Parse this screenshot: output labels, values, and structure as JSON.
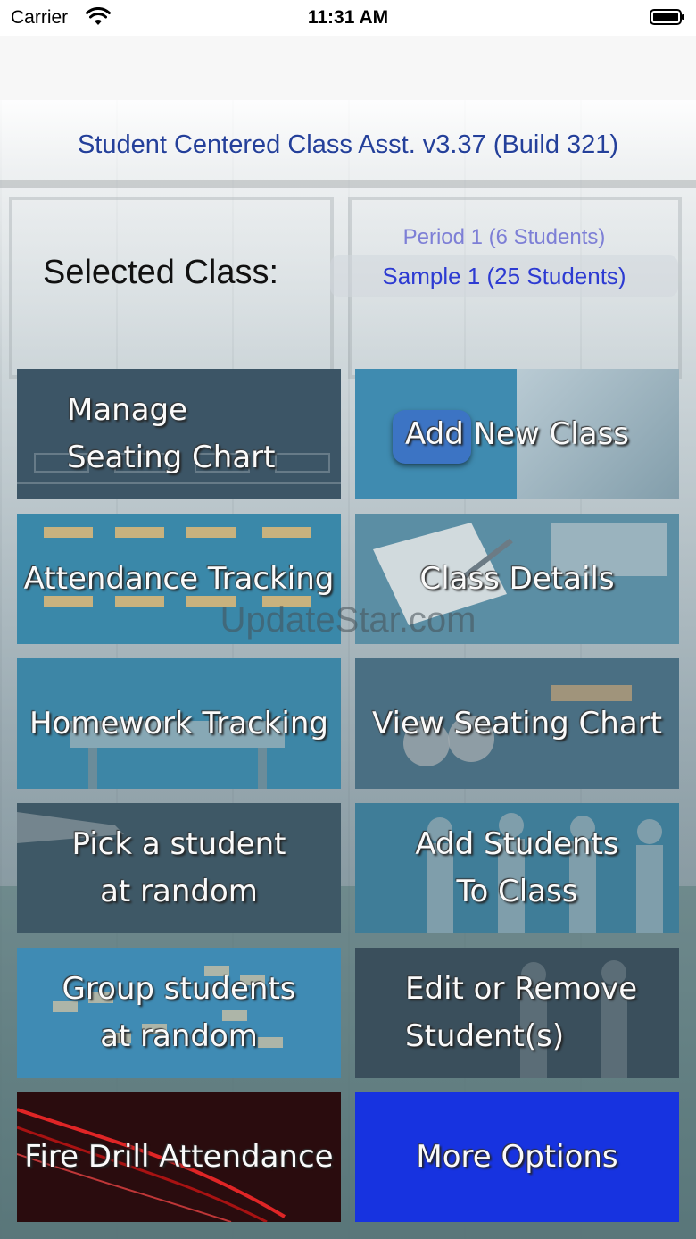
{
  "status_bar": {
    "carrier": "Carrier",
    "time": "11:31 AM",
    "wifi_icon": "wifi-icon",
    "battery_icon": "battery-icon"
  },
  "app_title": "Student Centered Class Asst. v3.37 (Build 321)",
  "selected_class": {
    "label": "Selected Class:",
    "options": [
      "Period 1 (6 Students)",
      "Sample 1 (25 Students)"
    ],
    "selected": "Sample 1 (25 Students)"
  },
  "tiles": [
    {
      "id": "manage-seating-chart",
      "label": "Manage\nSeating Chart",
      "color": "#3c5566"
    },
    {
      "id": "add-new-class",
      "label": "Add New Class",
      "color": "#3f8bb0"
    },
    {
      "id": "attendance-tracking",
      "label": "Attendance Tracking",
      "color": "#3a88a9"
    },
    {
      "id": "class-details",
      "label": "Class Details",
      "color": "#5b8ea4"
    },
    {
      "id": "homework-tracking",
      "label": "Homework Tracking",
      "color": "#3d86a6"
    },
    {
      "id": "view-seating-chart",
      "label": "View Seating Chart",
      "color": "#4a6f83"
    },
    {
      "id": "pick-student-random",
      "label": "Pick a student\nat random",
      "color": "#3e5866"
    },
    {
      "id": "add-students",
      "label": "Add Students\nTo Class",
      "color": "#3f7d98"
    },
    {
      "id": "group-students-random",
      "label": "Group students\nat random",
      "color": "#3f8bb4"
    },
    {
      "id": "edit-remove-students",
      "label": "Edit or Remove\nStudent(s)",
      "color": "#3a4f5c"
    },
    {
      "id": "fire-drill-attendance",
      "label": "Fire Drill Attendance",
      "color": "#2a0c0e"
    },
    {
      "id": "more-options",
      "label": "More Options",
      "color": "#1733e0"
    }
  ],
  "watermark": "UpdateStar.com"
}
